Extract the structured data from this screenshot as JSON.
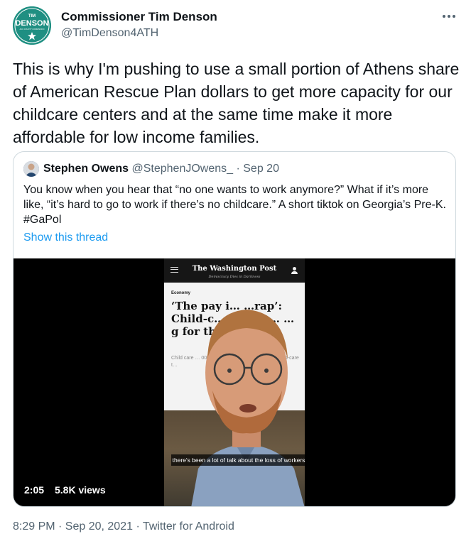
{
  "author": {
    "name": "Commissioner Tim Denson",
    "handle": "@TimDenson4ATH",
    "avatar_text_top": "TIM",
    "avatar_text_main": "DENSON",
    "avatar_text_sub": "ACC COUNTY COMMISSION",
    "avatar_color": "#1f8f82"
  },
  "more_icon": "more-horizontal-icon",
  "tweet_text": "This is why I'm pushing to use a small portion of Athens share of American Rescue Plan dollars to get more capacity for our childcare centers and at the same time make it more affordable for low income families.",
  "quoted_tweet": {
    "author_name": "Stephen Owens",
    "author_handle": "@StephenJOwens_",
    "date": "· Sep 20",
    "text": "You know when you hear that “no one wants to work anymore?” What if it’s more like, “it’s hard to go to work if there’s no childcare.” A short tiktok on Georgia’s Pre-K. #GaPol",
    "show_thread_label": "Show this thread",
    "link_color": "#1d9bf0",
    "video": {
      "duration": "2:05",
      "views": "5.8K views",
      "caption": "there's been a lot of talk about the loss of workers",
      "article": {
        "masthead": "The Washington Post",
        "tagline": "Democracy Dies in Darkness",
        "section": "Economy",
        "headline": "‘The pay i… …rap’: Child-c… quittin… …g for th…",
        "body_snippet": "Child care … 000 positions … s as bank … ks. P… d-care t…"
      }
    }
  },
  "meta": "8:29 PM · Sep 20, 2021 · Twitter for Android"
}
